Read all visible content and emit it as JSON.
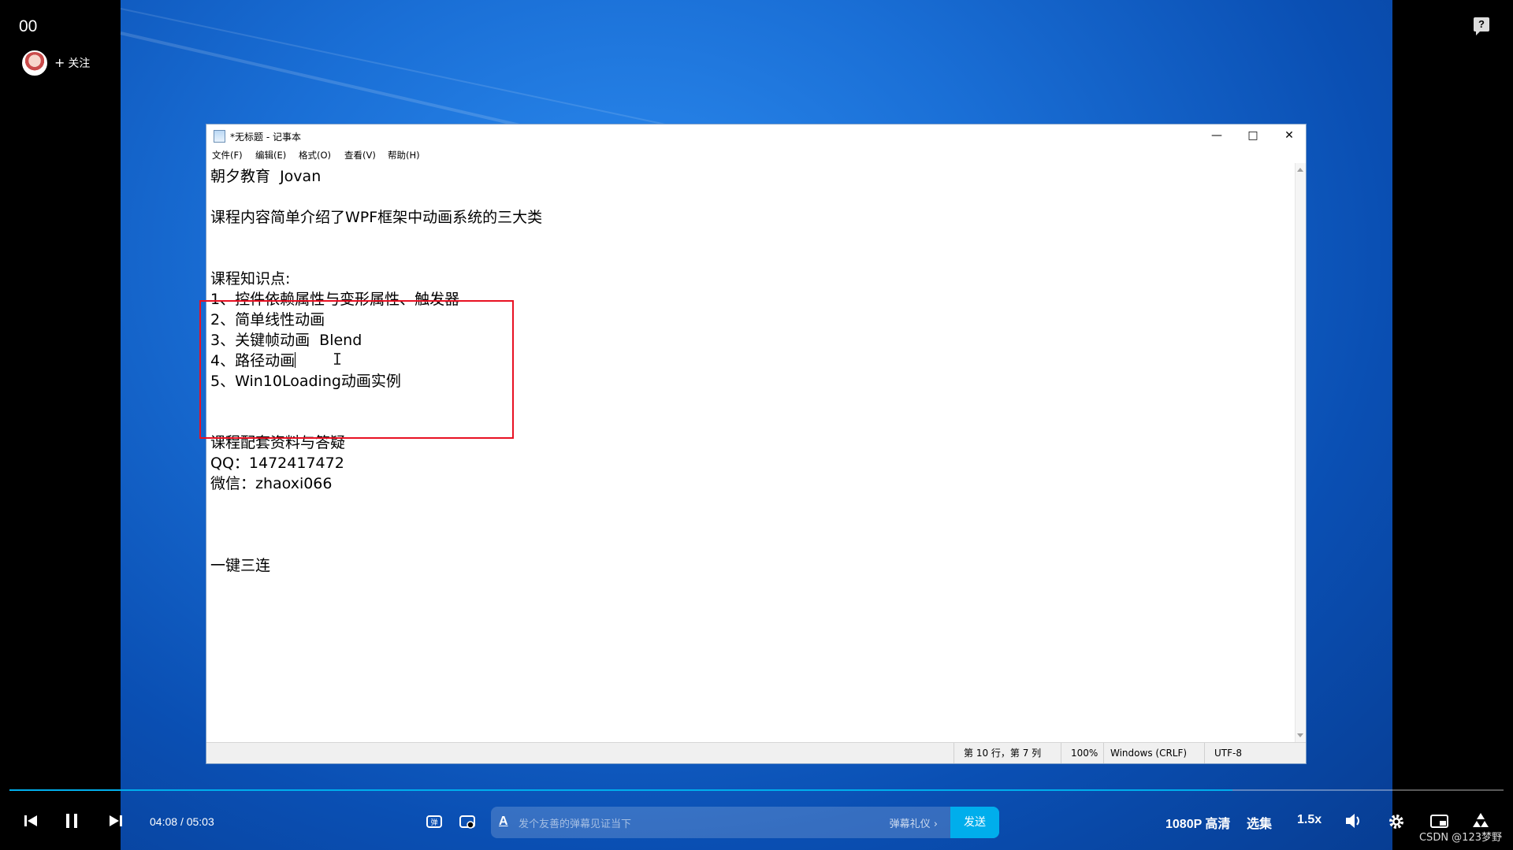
{
  "player": {
    "video_title": "00",
    "follow_label": "关注",
    "time_current": "04:08",
    "time_separator": "/",
    "time_total": "05:03",
    "progress": 0.8185,
    "danmaku_placeholder": "发个友善的弹幕见证当下",
    "danmaku_etiquette": "弹幕礼仪 ›",
    "send_label": "发送",
    "quality_label": "1080P 高清",
    "episodes_label": "选集",
    "speed_label": "1.5x",
    "watermark": "CSDN @123梦野",
    "accent_color": "#00aeec"
  },
  "notepad": {
    "title": "*无标题 - 记事本",
    "menu": [
      "文件(F)",
      "编辑(E)",
      "格式(O)",
      "查看(V)",
      "帮助(H)"
    ],
    "lines": [
      "朝夕教育  Jovan",
      "",
      "课程内容简单介绍了WPF框架中动画系统的三大类",
      "",
      "",
      "课程知识点:",
      "1、控件依赖属性与变形属性、触发器",
      "2、简单线性动画",
      "3、关键帧动画  Blend",
      "4、路径动画",
      "5、Win10Loading动画实例",
      "",
      "",
      "课程配套资料与答疑",
      "QQ：1472417472",
      "微信：zhaoxi066",
      "",
      "",
      "",
      "一键三连"
    ],
    "status": {
      "position": "第 10 行，第 7 列",
      "zoom": "100%",
      "line_ending": "Windows (CRLF)",
      "encoding": "UTF-8"
    }
  }
}
